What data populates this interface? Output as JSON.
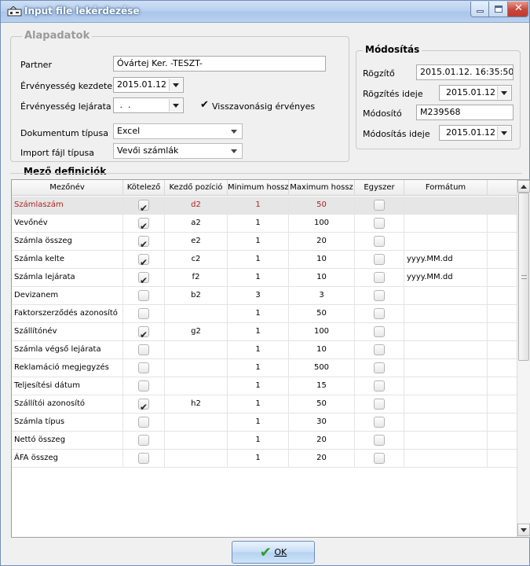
{
  "window": {
    "title": "Input file lekérdezése"
  },
  "alapadatok": {
    "group_label": "Alapadatok",
    "partner_label": "Partner",
    "partner_value": "Óvártej Ker. -TESZT-",
    "ervenyesseg_kezdete_label": "Érvényesség kezdete",
    "ervenyesseg_kezdete_value": "2015.01.12",
    "ervenyesseg_lejarata_label": "Érvényesség lejárata",
    "ervenyesseg_lejarata_value": " .  . ",
    "visszavonasig_label": "Visszavonásig érvényes",
    "dokumentum_tipusa_label": "Dokumentum típusa",
    "dokumentum_tipusa_value": "Excel",
    "import_fajl_tipusa_label": "Import fájl típusa",
    "import_fajl_tipusa_value": "Vevői számlák"
  },
  "modositas": {
    "group_label": "Módosítás",
    "rogzito_label": "Rögzítő",
    "rogzito_value": "2015.01.12. 16:35:50",
    "rogzites_ideje_label": "Rögzítés ideje",
    "rogzites_ideje_value": "2015.01.12",
    "modosito_label": "Módosító",
    "modosito_value": "M239568",
    "modositas_ideje_label": "Módosítás ideje",
    "modositas_ideje_value": "2015.01.12"
  },
  "mezo": {
    "group_label": "Mező definiciók",
    "columns": [
      "Mezőnév",
      "Kötelező",
      "Kezdő pozíció",
      "Minimum hossz",
      "Maximum hossz",
      "Egyszer",
      "Formátum"
    ],
    "rows": [
      {
        "name": "Számlaszám",
        "kotelezo": true,
        "kezdo": "d2",
        "min": "1",
        "max": "50",
        "egyszer": false,
        "format": ""
      },
      {
        "name": "Vevőnév",
        "kotelezo": true,
        "kezdo": "a2",
        "min": "1",
        "max": "100",
        "egyszer": false,
        "format": ""
      },
      {
        "name": "Számla összeg",
        "kotelezo": true,
        "kezdo": "e2",
        "min": "1",
        "max": "20",
        "egyszer": false,
        "format": ""
      },
      {
        "name": "Számla kelte",
        "kotelezo": true,
        "kezdo": "c2",
        "min": "1",
        "max": "10",
        "egyszer": false,
        "format": "yyyy.MM.dd"
      },
      {
        "name": "Számla lejárata",
        "kotelezo": true,
        "kezdo": "f2",
        "min": "1",
        "max": "10",
        "egyszer": false,
        "format": "yyyy.MM.dd"
      },
      {
        "name": "Devizanem",
        "kotelezo": false,
        "kezdo": "b2",
        "min": "3",
        "max": "3",
        "egyszer": false,
        "format": ""
      },
      {
        "name": "Faktorszerződés azonosító",
        "kotelezo": false,
        "kezdo": "",
        "min": "1",
        "max": "50",
        "egyszer": false,
        "format": ""
      },
      {
        "name": "Szállítónév",
        "kotelezo": true,
        "kezdo": "g2",
        "min": "1",
        "max": "100",
        "egyszer": false,
        "format": ""
      },
      {
        "name": "Számla végső lejárata",
        "kotelezo": false,
        "kezdo": "",
        "min": "1",
        "max": "10",
        "egyszer": false,
        "format": ""
      },
      {
        "name": "Reklamáció megjegyzés",
        "kotelezo": false,
        "kezdo": "",
        "min": "1",
        "max": "500",
        "egyszer": false,
        "format": ""
      },
      {
        "name": "Teljesítési dátum",
        "kotelezo": false,
        "kezdo": "",
        "min": "1",
        "max": "15",
        "egyszer": false,
        "format": ""
      },
      {
        "name": "Szállítói azonosító",
        "kotelezo": true,
        "kezdo": "h2",
        "min": "1",
        "max": "50",
        "egyszer": false,
        "format": ""
      },
      {
        "name": "Számla típus",
        "kotelezo": false,
        "kezdo": "",
        "min": "1",
        "max": "30",
        "egyszer": false,
        "format": ""
      },
      {
        "name": "Nettó összeg",
        "kotelezo": false,
        "kezdo": "",
        "min": "1",
        "max": "20",
        "egyszer": false,
        "format": ""
      },
      {
        "name": "ÁFA összeg",
        "kotelezo": false,
        "kezdo": "",
        "min": "1",
        "max": "20",
        "egyszer": false,
        "format": ""
      }
    ],
    "selected_row": 0
  },
  "ok_button": {
    "label": "OK"
  },
  "colors": {
    "selected_text": "#b22222",
    "selected_bg": "#e6e6e6",
    "ok_check": "#2e9e2e"
  }
}
